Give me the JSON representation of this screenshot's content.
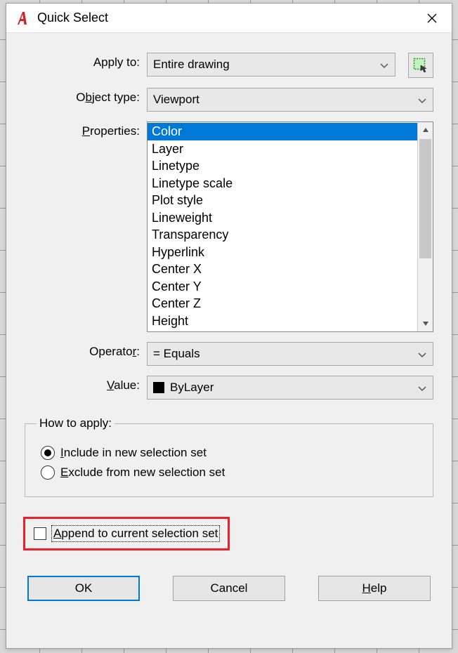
{
  "title": "Quick Select",
  "labels": {
    "apply_to": "Apply to:",
    "object_type": "Object type:",
    "properties": "Properties:",
    "operator": "Operator:",
    "value": "Value:"
  },
  "fields": {
    "apply_to": "Entire drawing",
    "object_type": "Viewport",
    "operator": "= Equals",
    "value": "ByLayer"
  },
  "properties_list": [
    "Color",
    "Layer",
    "Linetype",
    "Linetype scale",
    "Plot style",
    "Lineweight",
    "Transparency",
    "Hyperlink",
    "Center X",
    "Center Y",
    "Center Z",
    "Height"
  ],
  "properties_selected_index": 0,
  "group": {
    "legend": "How to apply:",
    "include": "Include in new selection set",
    "exclude": "Exclude from new selection set",
    "selected": "include"
  },
  "append_label": "Append to current selection set",
  "append_checked": false,
  "buttons": {
    "ok": "OK",
    "cancel": "Cancel",
    "help": "Help"
  }
}
